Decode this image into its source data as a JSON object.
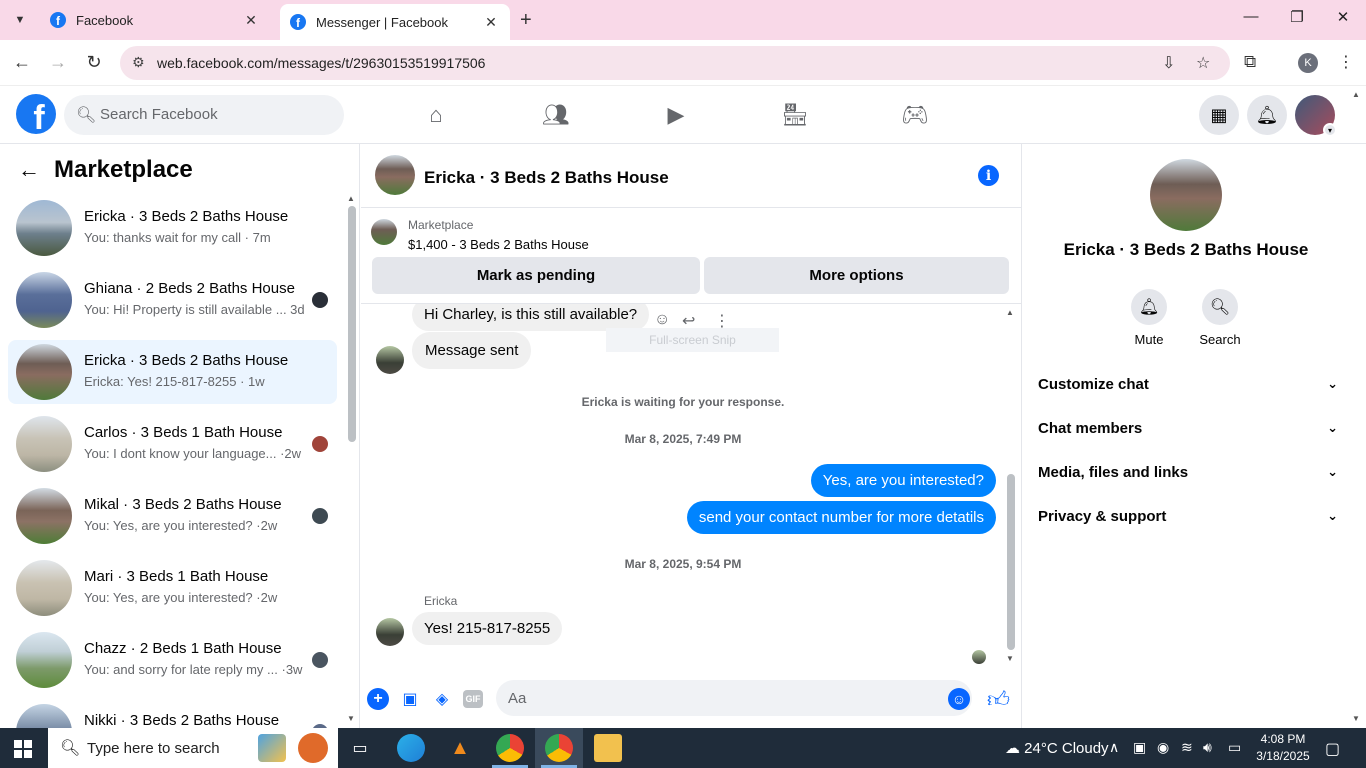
{
  "browser": {
    "tabs": [
      {
        "title": "Facebook",
        "active": false
      },
      {
        "title": "Messenger | Facebook",
        "active": true
      }
    ],
    "url": "web.facebook.com/messages/t/29630153519917506",
    "profile_initial": "K"
  },
  "fb": {
    "search_placeholder": "Search Facebook",
    "brand_color": "#1877f2"
  },
  "sidebar": {
    "title": "Marketplace",
    "conversations": [
      {
        "name": "Ericka · 3 Beds 2 Baths House",
        "snippet": "You: thanks wait for my call · 7m"
      },
      {
        "name": "Ghiana · 2 Beds 2 Baths House",
        "snippet": "You: Hi! Property is still available ... 3d"
      },
      {
        "name": "Ericka · 3 Beds 2 Baths House",
        "snippet": "Ericka: Yes! 215-817-8255 · 1w"
      },
      {
        "name": "Carlos · 3 Beds 1 Bath House",
        "snippet": "You: I dont know your language... ·2w"
      },
      {
        "name": "Mikal · 3 Beds 2 Baths House",
        "snippet": "You: Yes, are you interested? ·2w"
      },
      {
        "name": "Mari · 3 Beds 1 Bath House",
        "snippet": "You: Yes, are you interested? ·2w"
      },
      {
        "name": "Chazz · 2 Beds 1 Bath House",
        "snippet": "You: and sorry for late reply my ... ·3w"
      },
      {
        "name": "Nikki · 3 Beds 2 Baths House",
        "snippet": ""
      }
    ]
  },
  "chat": {
    "title": "Ericka · 3 Beds 2 Baths House",
    "listing_label": "Marketplace",
    "listing_price": "$1,400 - 3 Beds 2 Baths House",
    "btn_pending": "Mark as pending",
    "btn_more": "More options",
    "msg_question": "Hi Charley, is this still available?",
    "msg_sent": "Message sent",
    "snip_tip": "Full-screen Snip",
    "waiting": "Ericka is waiting for your response.",
    "time1": "Mar 8, 2025, 7:49 PM",
    "out1": "Yes, are you interested?",
    "out2": "send your contact number for more detatils",
    "time2": "Mar 8, 2025, 9:54 PM",
    "sender": "Ericka",
    "in_reply": "Yes! 215-817-8255",
    "composer_placeholder": "Aa",
    "accent": "#0084ff"
  },
  "info_panel": {
    "name": "Ericka · 3 Beds 2 Baths House",
    "mute": "Mute",
    "search": "Search",
    "sections": [
      "Customize chat",
      "Chat members",
      "Media, files and links",
      "Privacy & support"
    ]
  },
  "taskbar": {
    "search_placeholder": "Type here to search",
    "weather": "24°C  Cloudy",
    "time": "4:08 PM",
    "date": "3/18/2025"
  }
}
